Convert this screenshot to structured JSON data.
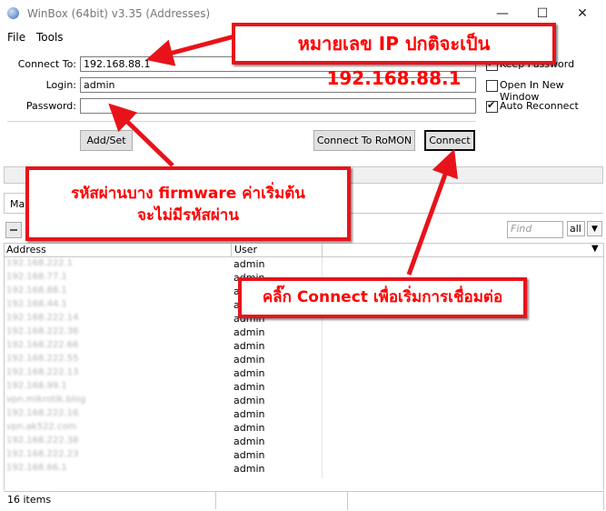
{
  "window": {
    "title": "WinBox (64bit) v3.35 (Addresses)",
    "minimize": "—",
    "maximize": "☐",
    "close": "✕"
  },
  "menu": {
    "file": "File",
    "tools": "Tools"
  },
  "form": {
    "connect_to_label": "Connect To:",
    "connect_to_value": "192.168.88.1",
    "login_label": "Login:",
    "login_value": "admin",
    "password_label": "Password:",
    "password_value": "",
    "keep_password_label": "Keep Password",
    "keep_password_checked": true,
    "open_new_window_label": "Open In New Window",
    "open_new_window_checked": false,
    "auto_reconnect_label": "Auto Reconnect",
    "auto_reconnect_checked": true,
    "add_set_button": "Add/Set",
    "connect_romon_button": "Connect To RoMON",
    "connect_button": "Connect"
  },
  "tab": {
    "label": "Ma"
  },
  "toolbar": {
    "find_placeholder": "Find",
    "filter_value": "all",
    "dropdown_icon": "down-arrow"
  },
  "table": {
    "columns": [
      "Address",
      "User"
    ],
    "rows": [
      {
        "address": "192.168.222.1",
        "user": "admin"
      },
      {
        "address": "192.168.77.1",
        "user": "admin"
      },
      {
        "address": "192.168.88.1",
        "user": "admin"
      },
      {
        "address": "192.168.44.1",
        "user": "admin"
      },
      {
        "address": "192.168.222.14",
        "user": "admin"
      },
      {
        "address": "192.168.222.36",
        "user": "admin"
      },
      {
        "address": "192.168.222.66",
        "user": "admin"
      },
      {
        "address": "192.168.222.55",
        "user": "admin"
      },
      {
        "address": "192.168.222.13",
        "user": "admin"
      },
      {
        "address": "192.168.99.1",
        "user": "admin"
      },
      {
        "address": "vpn.mikrotik.blog",
        "user": "admin"
      },
      {
        "address": "192.168.222.16",
        "user": "admin"
      },
      {
        "address": "vpn.ak522.com",
        "user": "admin"
      },
      {
        "address": "192.168.222.38",
        "user": "admin"
      },
      {
        "address": "192.168.222.23",
        "user": "admin"
      },
      {
        "address": "192.168.66.1",
        "user": "admin"
      }
    ]
  },
  "status": {
    "items": "16 items"
  },
  "callouts": {
    "ip": "หมายเลข IP ปกติจะเป็น 192.168.88.1",
    "password_line1": "รหัสผ่านบาง firmware ค่าเริ่มต้น",
    "password_line2": "จะไม่มีรหัสผ่าน",
    "connect": "คลิ๊ก Connect เพื่อเริ่มการเชื่อมต่อ"
  },
  "colors": {
    "callout_border": "#e8131a",
    "callout_text": "#ff0000"
  }
}
